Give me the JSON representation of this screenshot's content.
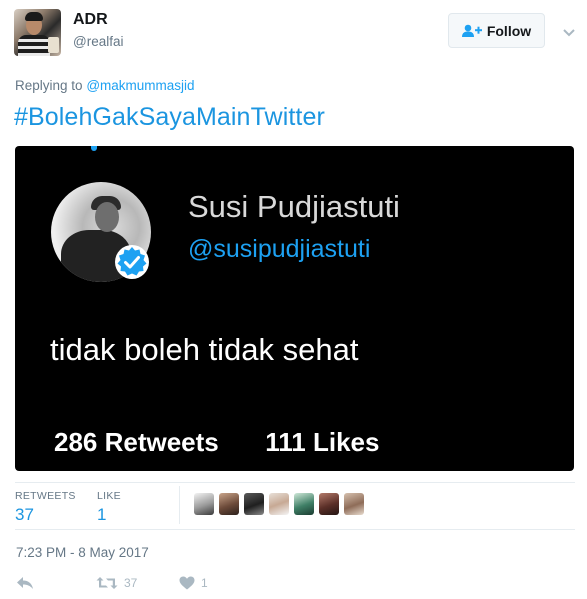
{
  "tweet": {
    "author_name": "ADR",
    "author_handle": "@realfai",
    "follow_label": "Follow",
    "replying_prefix": "Replying to",
    "replying_to": "@makmummasjid",
    "text": "#BolehGakSayaMainTwitter",
    "timestamp": "7:23 PM - 8 May 2017"
  },
  "media": {
    "name": "Susi Pudjiastuti",
    "handle": "@susipudjiastuti",
    "text": "tidak boleh tidak sehat",
    "retweets": "286 Retweets",
    "likes": "111 Likes"
  },
  "stats": {
    "retweets_label": "RETWEETS",
    "retweets_value": "37",
    "likes_label": "LIKE",
    "likes_value": "1"
  },
  "actions": {
    "retweet_count": "37",
    "like_count": "1"
  },
  "icons": {
    "follow": "add-user-icon",
    "caret": "chevron-down-icon",
    "verified": "verified-badge-icon",
    "reply": "reply-icon",
    "retweet": "retweet-icon",
    "like": "heart-icon"
  },
  "colors": {
    "accent": "#1da1f2",
    "link": "#1b95e0",
    "muted": "#657786",
    "icon_muted": "#aab8c2",
    "media_bg": "#000000"
  }
}
